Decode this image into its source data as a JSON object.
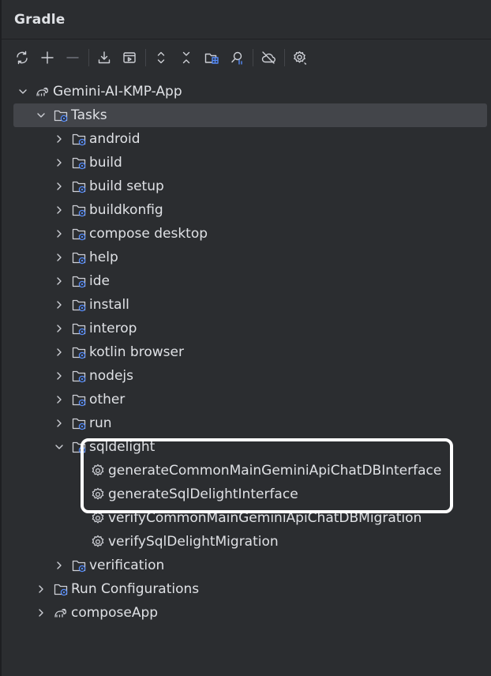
{
  "header": {
    "title": "Gradle"
  },
  "toolbar": {
    "buttons": [
      {
        "icon": "refresh-icon"
      },
      {
        "icon": "plus-icon"
      },
      {
        "icon": "minus-icon"
      },
      {
        "icon": "download-icon"
      },
      {
        "icon": "run-config-icon"
      },
      {
        "icon": "expand-all-icon"
      },
      {
        "icon": "collapse-all-icon"
      },
      {
        "icon": "group-modules-icon"
      },
      {
        "icon": "analyze-dependencies-icon"
      },
      {
        "icon": "offline-mode-icon"
      },
      {
        "icon": "settings-icon"
      }
    ]
  },
  "tree": {
    "root": "Gemini-AI-KMP-App",
    "tasks": "Tasks",
    "groups": [
      "android",
      "build",
      "build setup",
      "buildkonfig",
      "compose desktop",
      "help",
      "ide",
      "install",
      "interop",
      "kotlin browser",
      "nodejs",
      "other",
      "run"
    ],
    "sqldelight": "sqldelight",
    "sqldelight_tasks": [
      "generateCommonMainGeminiApiChatDBInterface",
      "generateSqlDelightInterface",
      "verifyCommonMainGeminiApiChatDBMigration",
      "verifySqlDelightMigration"
    ],
    "verification": "verification",
    "run_configurations": "Run Configurations",
    "compose_app": "composeApp"
  },
  "colors": {
    "background": "#2b2d30",
    "selection": "#43454a",
    "text": "#dfe1e5",
    "icon_blue": "#548af7",
    "annotation": "#ffffff"
  }
}
